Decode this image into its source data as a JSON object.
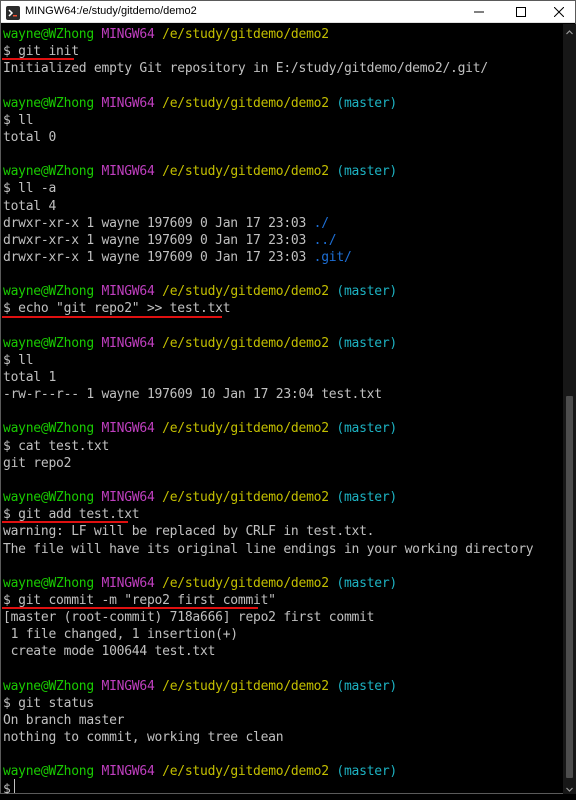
{
  "window": {
    "title": "MINGW64:/e/study/gitdemo/demo2",
    "icon": "git-bash-icon"
  },
  "prompt": {
    "user": "wayne@WZhong",
    "host": "MINGW64",
    "path": "/e/study/gitdemo/demo2",
    "branch": "(master)",
    "symbol": "$"
  },
  "colors": {
    "background": "#000000",
    "text": "#c0c0c0",
    "user": "#19cb00",
    "host": "#c03fc0",
    "path": "#c3bf00",
    "branch": "#1db2c2",
    "directory": "#1d6fd6",
    "annotation": "#e01010"
  },
  "session": [
    {
      "type": "prompt",
      "branch": false
    },
    {
      "type": "cmd",
      "text": "$ git init"
    },
    {
      "type": "out",
      "text": "Initialized empty Git repository in E:/study/gitdemo/demo2/.git/"
    },
    {
      "type": "blank"
    },
    {
      "type": "prompt",
      "branch": true
    },
    {
      "type": "cmd",
      "text": "$ ll"
    },
    {
      "type": "out",
      "text": "total 0"
    },
    {
      "type": "blank"
    },
    {
      "type": "prompt",
      "branch": true
    },
    {
      "type": "cmd",
      "text": "$ ll -a"
    },
    {
      "type": "out",
      "text": "total 4"
    },
    {
      "type": "dir",
      "text": "drwxr-xr-x 1 wayne 197609 0 Jan 17 23:03 ",
      "name": "./"
    },
    {
      "type": "dir",
      "text": "drwxr-xr-x 1 wayne 197609 0 Jan 17 23:03 ",
      "name": "../"
    },
    {
      "type": "dir",
      "text": "drwxr-xr-x 1 wayne 197609 0 Jan 17 23:03 ",
      "name": ".git/"
    },
    {
      "type": "blank"
    },
    {
      "type": "prompt",
      "branch": true
    },
    {
      "type": "cmd",
      "text": "$ echo \"git repo2\" >> test.txt"
    },
    {
      "type": "blank"
    },
    {
      "type": "prompt",
      "branch": true
    },
    {
      "type": "cmd",
      "text": "$ ll"
    },
    {
      "type": "out",
      "text": "total 1"
    },
    {
      "type": "out",
      "text": "-rw-r--r-- 1 wayne 197609 10 Jan 17 23:04 test.txt"
    },
    {
      "type": "blank"
    },
    {
      "type": "prompt",
      "branch": true
    },
    {
      "type": "cmd",
      "text": "$ cat test.txt"
    },
    {
      "type": "out",
      "text": "git repo2"
    },
    {
      "type": "blank"
    },
    {
      "type": "prompt",
      "branch": true
    },
    {
      "type": "cmd",
      "text": "$ git add test.txt"
    },
    {
      "type": "out",
      "text": "warning: LF will be replaced by CRLF in test.txt."
    },
    {
      "type": "out",
      "text": "The file will have its original line endings in your working directory"
    },
    {
      "type": "blank"
    },
    {
      "type": "prompt",
      "branch": true
    },
    {
      "type": "cmd",
      "text": "$ git commit -m \"repo2 first commit\""
    },
    {
      "type": "out",
      "text": "[master (root-commit) 718a666] repo2 first commit"
    },
    {
      "type": "out",
      "text": " 1 file changed, 1 insertion(+)"
    },
    {
      "type": "out",
      "text": " create mode 100644 test.txt"
    },
    {
      "type": "blank"
    },
    {
      "type": "prompt",
      "branch": true
    },
    {
      "type": "cmd",
      "text": "$ git status"
    },
    {
      "type": "out",
      "text": "On branch master"
    },
    {
      "type": "out",
      "text": "nothing to commit, working tree clean"
    },
    {
      "type": "blank"
    },
    {
      "type": "prompt",
      "branch": true
    },
    {
      "type": "cmd",
      "text": "$ "
    }
  ]
}
